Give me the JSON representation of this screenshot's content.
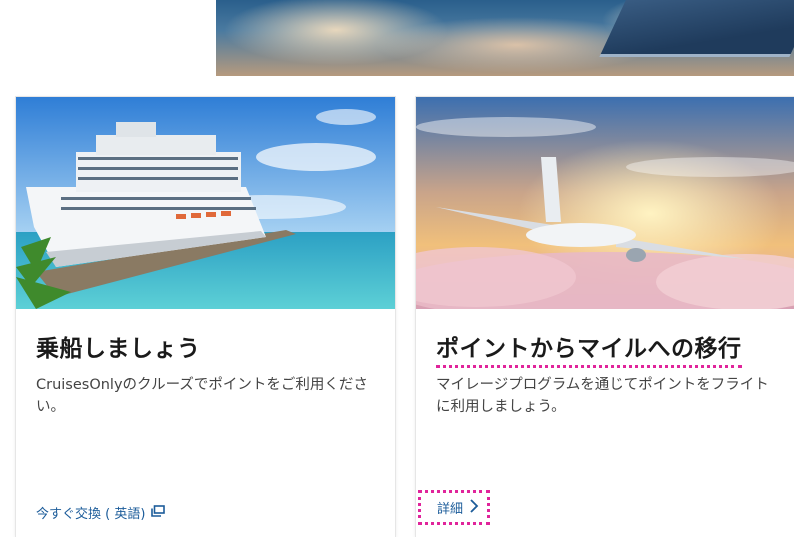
{
  "hero": {
    "icon": "airplane-wing-sky-image"
  },
  "cards": [
    {
      "title": "乗船しましょう",
      "description": "CruisesOnlyのクルーズでポイントをご利用ください。",
      "link_label": "今すぐ交換 ( 英語)",
      "link_icon": "external-window-icon",
      "image": "cruise-ship-image"
    },
    {
      "title": "ポイントからマイルへの移行",
      "description": "マイレージプログラムを通じてポイントをフライトに利用しましょう。",
      "link_label": "詳細",
      "link_icon": "chevron-right-icon",
      "image": "airplane-flight-image"
    }
  ],
  "colors": {
    "link": "#1c5c9a",
    "highlight": "#e0249b",
    "title": "#1a1a1a"
  }
}
